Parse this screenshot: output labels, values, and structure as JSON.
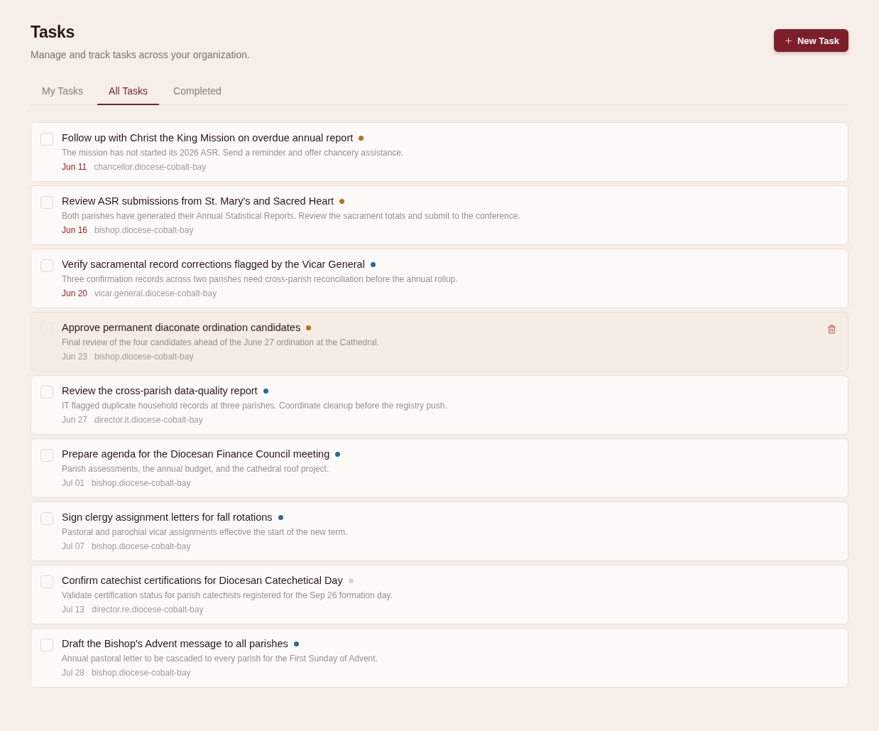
{
  "header": {
    "title": "Tasks",
    "subtitle": "Manage and track tasks across your organization.",
    "new_button": {
      "label": "New Task"
    }
  },
  "tabs": [
    {
      "label": "My Tasks",
      "selected": false
    },
    {
      "label": "All Tasks",
      "selected": true
    },
    {
      "label": "Completed",
      "selected": false
    }
  ],
  "tasks": [
    {
      "title": "Follow up with Christ the King Mission on overdue annual report",
      "color": "#b8721f",
      "description": "The mission has not started its 2026 ASR. Send a reminder and offer chancery assistance.",
      "due": "Jun 11",
      "overdue": true,
      "assignee": "chancellor.diocese-cobalt-bay",
      "checked": false,
      "highlighted": false
    },
    {
      "title": "Review ASR submissions from St. Mary's and Sacred Heart",
      "color": "#b8721f",
      "description": "Both parishes have generated their Annual Statistical Reports. Review the sacrament totals and submit to the conference.",
      "due": "Jun 16",
      "overdue": true,
      "assignee": "bishop.diocese-cobalt-bay",
      "checked": false,
      "highlighted": false
    },
    {
      "title": "Verify sacramental record corrections flagged by the Vicar General",
      "color": "#2d6a8e",
      "description": "Three confirmation records across two parishes need cross-parish reconciliation before the annual rollup.",
      "due": "Jun 20",
      "overdue": true,
      "assignee": "vicar.general.diocese-cobalt-bay",
      "checked": false,
      "highlighted": false
    },
    {
      "title": "Approve permanent diaconate ordination candidates",
      "color": "#b8721f",
      "description": "Final review of the four candidates ahead of the June 27 ordination at the Cathedral.",
      "due": "Jun 23",
      "overdue": false,
      "assignee": "bishop.diocese-cobalt-bay",
      "checked": false,
      "highlighted": true
    },
    {
      "title": "Review the cross-parish data-quality report",
      "color": "#2d6a8e",
      "description": "IT flagged duplicate household records at three parishes. Coordinate cleanup before the registry push.",
      "due": "Jun 27",
      "overdue": false,
      "assignee": "director.it.diocese-cobalt-bay",
      "checked": false,
      "highlighted": false
    },
    {
      "title": "Prepare agenda for the Diocesan Finance Council meeting",
      "color": "#2d6a8e",
      "description": "Parish assessments, the annual budget, and the cathedral roof project.",
      "due": "Jul 01",
      "overdue": false,
      "assignee": "bishop.diocese-cobalt-bay",
      "checked": false,
      "highlighted": false
    },
    {
      "title": "Sign clergy assignment letters for fall rotations",
      "color": "#2d6a8e",
      "description": "Pastoral and parochial vicar assignments effective the start of the new term.",
      "due": "Jul 07",
      "overdue": false,
      "assignee": "bishop.diocese-cobalt-bay",
      "checked": false,
      "highlighted": false
    },
    {
      "title": "Confirm catechist certifications for Diocesan Catechetical Day",
      "color": "#d8d4d2",
      "description": "Validate certification status for parish catechists registered for the Sep 26 formation day.",
      "due": "Jul 13",
      "overdue": false,
      "assignee": "director.re.diocese-cobalt-bay",
      "checked": false,
      "highlighted": false
    },
    {
      "title": "Draft the Bishop's Advent message to all parishes",
      "color": "#2d6a8e",
      "description": "Annual pastoral letter to be cascaded to every parish for the First Sunday of Advent.",
      "due": "Jul 28",
      "overdue": false,
      "assignee": "bishop.diocese-cobalt-bay",
      "checked": false,
      "highlighted": false
    }
  ]
}
